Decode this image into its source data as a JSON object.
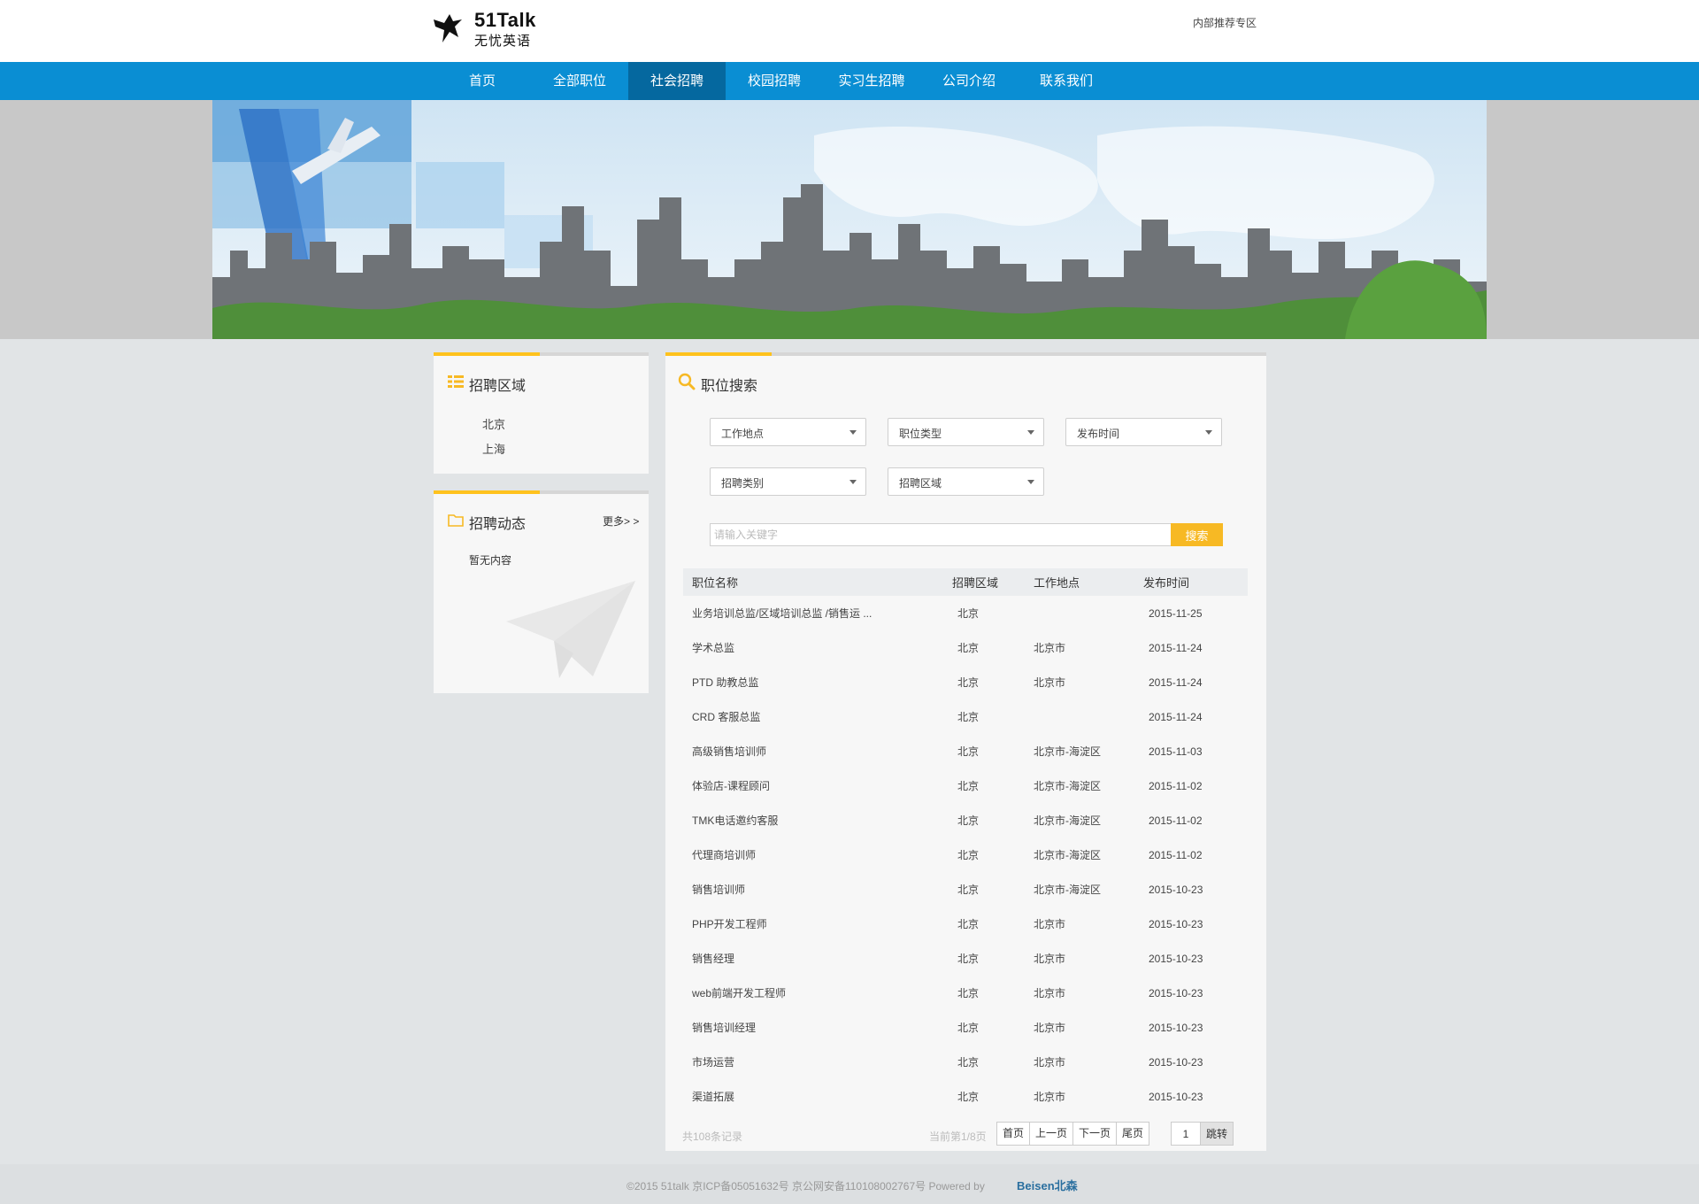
{
  "header": {
    "brand": "51Talk",
    "brand_sub": "无忧英语",
    "inner_link": "内部推荐专区"
  },
  "nav": {
    "items": [
      "首页",
      "全部职位",
      "社会招聘",
      "校园招聘",
      "实习生招聘",
      "公司介绍",
      "联系我们"
    ],
    "active": "社会招聘"
  },
  "region_panel": {
    "title": "招聘区域",
    "items": [
      "北京",
      "上海"
    ]
  },
  "news_panel": {
    "title": "招聘动态",
    "more": "更多> >",
    "empty": "暂无内容"
  },
  "search_panel": {
    "title": "职位搜索",
    "filters": [
      "工作地点",
      "职位类型",
      "发布时间",
      "招聘类别",
      "招聘区域"
    ],
    "keyword_placeholder": "请输入关键字",
    "search_button": "搜索"
  },
  "table": {
    "headers": [
      "职位名称",
      "招聘区域",
      "工作地点",
      "发布时间"
    ],
    "rows": [
      {
        "name": "业务培训总监/区域培训总监 /销售运 ...",
        "region": "北京",
        "location": "",
        "date": "2015-11-25"
      },
      {
        "name": "学术总监",
        "region": "北京",
        "location": "北京市",
        "date": "2015-11-24"
      },
      {
        "name": "PTD 助教总监",
        "region": "北京",
        "location": "北京市",
        "date": "2015-11-24"
      },
      {
        "name": "CRD 客服总监",
        "region": "北京",
        "location": "",
        "date": "2015-11-24"
      },
      {
        "name": "高级销售培训师",
        "region": "北京",
        "location": "北京市-海淀区",
        "date": "2015-11-03"
      },
      {
        "name": "体验店-课程顾问",
        "region": "北京",
        "location": "北京市-海淀区",
        "date": "2015-11-02"
      },
      {
        "name": "TMK电话邀约客服",
        "region": "北京",
        "location": "北京市-海淀区",
        "date": "2015-11-02"
      },
      {
        "name": "代理商培训师",
        "region": "北京",
        "location": "北京市-海淀区",
        "date": "2015-11-02"
      },
      {
        "name": "销售培训师",
        "region": "北京",
        "location": "北京市-海淀区",
        "date": "2015-10-23"
      },
      {
        "name": "PHP开发工程师",
        "region": "北京",
        "location": "北京市",
        "date": "2015-10-23"
      },
      {
        "name": "销售经理",
        "region": "北京",
        "location": "北京市",
        "date": "2015-10-23"
      },
      {
        "name": "web前端开发工程师",
        "region": "北京",
        "location": "北京市",
        "date": "2015-10-23"
      },
      {
        "name": "销售培训经理",
        "region": "北京",
        "location": "北京市",
        "date": "2015-10-23"
      },
      {
        "name": "市场运营",
        "region": "北京",
        "location": "北京市",
        "date": "2015-10-23"
      },
      {
        "name": "渠道拓展",
        "region": "北京",
        "location": "北京市",
        "date": "2015-10-23"
      }
    ]
  },
  "pager": {
    "total": "共108条记录",
    "current": "当前第1/8页",
    "first": "首页",
    "prev": "上一页",
    "next": "下一页",
    "last": "尾页",
    "page_value": "1",
    "jump": "跳转"
  },
  "footer": {
    "text": "©2015  51talk  京ICP备05051632号 京公网安备110108002767号  Powered by",
    "beisen": "Beisen北森"
  },
  "colors": {
    "nav_bg": "#0a8ed3",
    "nav_active": "#05689f",
    "accent": "#ffc21d",
    "search_button": "#f7b924"
  }
}
